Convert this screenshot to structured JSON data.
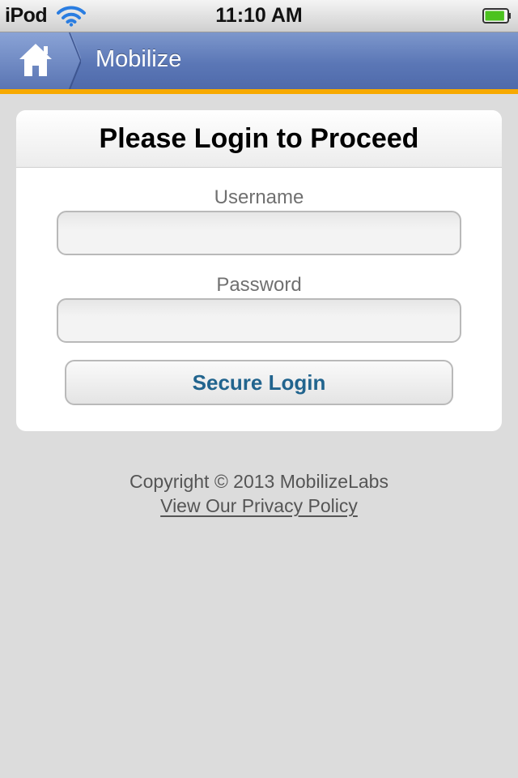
{
  "status_bar": {
    "carrier": "iPod",
    "time": "11:10 AM",
    "wifi_icon": "wifi-icon",
    "battery_icon": "battery-icon",
    "battery_level": 0.9
  },
  "nav": {
    "home_icon": "home-icon",
    "title": "Mobilize",
    "accent_color": "#f7a900",
    "bar_color": "#5b77b6"
  },
  "login": {
    "title": "Please Login to Proceed",
    "username_label": "Username",
    "username_value": "",
    "password_label": "Password",
    "password_value": "",
    "submit_label": "Secure Login",
    "submit_color": "#21648e"
  },
  "footer": {
    "copyright": "Copyright © 2013 MobilizeLabs",
    "privacy_link": "View Our Privacy Policy"
  }
}
